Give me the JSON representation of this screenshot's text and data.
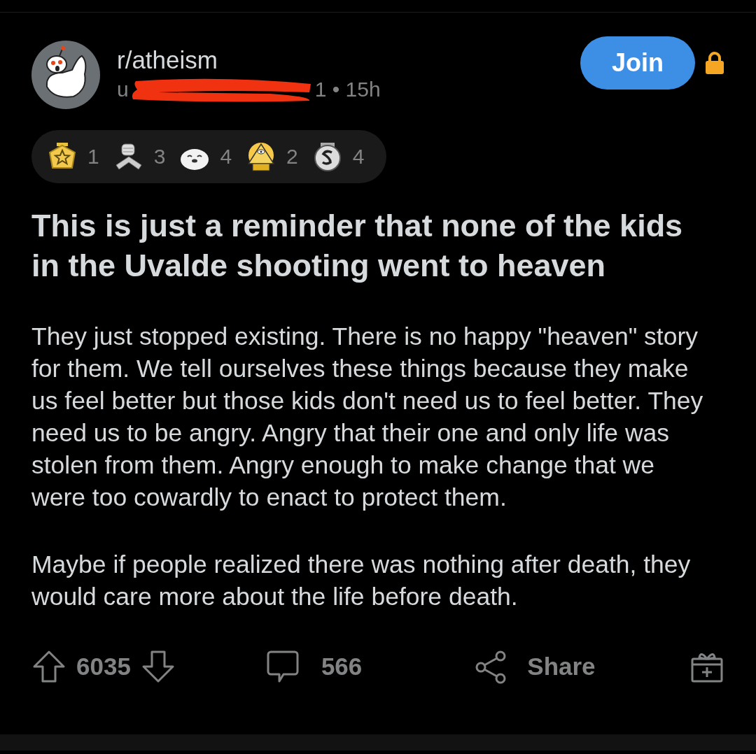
{
  "post": {
    "subreddit": "r/atheism",
    "author_prefix": "u",
    "age": "1 • 15h",
    "join_button": "Join",
    "locked": true,
    "awards": [
      {
        "kind": "star",
        "count": "1"
      },
      {
        "kind": "handshake",
        "count": "3"
      },
      {
        "kind": "seal",
        "count": "4"
      },
      {
        "kind": "pyramid",
        "count": "2"
      },
      {
        "kind": "coin",
        "count": "4"
      }
    ],
    "title": "This is just a reminder that none of the kids in the Uvalde shooting went to heaven",
    "paragraphs": [
      "They just stopped existing. There is no happy \"heaven\" story for them. We tell ourselves these things because they make us feel better but those kids don't need us to feel better. They need us to be angry. Angry that their one and only life was stolen from them. Angry enough to make change that we were too cowardly to enact to protect them.",
      "Maybe if people realized there was nothing after death, they would care more about the life before death."
    ],
    "actions": {
      "votes": "6035",
      "comments": "566",
      "share": "Share"
    }
  }
}
